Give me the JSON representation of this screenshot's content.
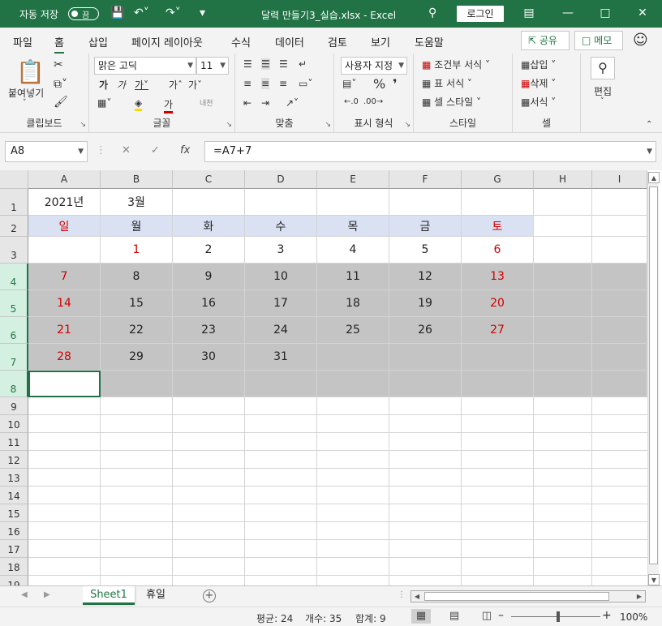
{
  "titlebar": {
    "autosave_label": "자동 저장",
    "autosave_state": "끔",
    "document_title": "달력 만들기3_실습.xlsx  -  Excel",
    "login_label": "로그인"
  },
  "menu": {
    "tabs": [
      "파일",
      "홈",
      "삽입",
      "페이지 레이아웃",
      "수식",
      "데이터",
      "검토",
      "보기",
      "도움말"
    ],
    "active_tab": "홈",
    "share_label": "공유",
    "memo_label": "메모"
  },
  "ribbon": {
    "clipboard": {
      "label": "클립보드",
      "paste_label": "붙여넣기"
    },
    "font": {
      "label": "글꼴",
      "font_name": "맑은 고딕",
      "font_size": "11"
    },
    "alignment": {
      "label": "맞춤"
    },
    "number": {
      "label": "표시 형식",
      "format": "사용자 지정"
    },
    "styles": {
      "label": "스타일",
      "conditional": "조건부 서식",
      "table": "표 서식",
      "cell": "셀 스타일"
    },
    "cells": {
      "label": "셀",
      "insert": "삽입",
      "delete": "삭제",
      "format": "서식"
    },
    "editing": {
      "label": "편집"
    }
  },
  "formula_bar": {
    "name_box": "A8",
    "formula": "=A7+7",
    "fx": "fx"
  },
  "columns": [
    "A",
    "B",
    "C",
    "D",
    "E",
    "F",
    "G",
    "H",
    "I"
  ],
  "rows": [
    "1",
    "2",
    "3",
    "4",
    "5",
    "6",
    "7",
    "8",
    "9",
    "10",
    "11",
    "12",
    "13",
    "14",
    "15",
    "16",
    "17",
    "18",
    "19"
  ],
  "sheet": {
    "year": "2021년",
    "month": "3월",
    "weekdays": [
      "일",
      "월",
      "화",
      "수",
      "목",
      "금",
      "토"
    ],
    "week1": [
      "",
      "1",
      "2",
      "3",
      "4",
      "5",
      "6"
    ],
    "week2": [
      "7",
      "8",
      "9",
      "10",
      "11",
      "12",
      "13"
    ],
    "week3": [
      "14",
      "15",
      "16",
      "17",
      "18",
      "19",
      "20"
    ],
    "week4": [
      "21",
      "22",
      "23",
      "24",
      "25",
      "26",
      "27"
    ],
    "week5": [
      "28",
      "29",
      "30",
      "31",
      "",
      "",
      ""
    ]
  },
  "sheet_tabs": [
    "Sheet1",
    "휴일"
  ],
  "active_sheet": "Sheet1",
  "status": {
    "average": "평균: 24",
    "count": "개수: 35",
    "sum": "합계: 9",
    "zoom": "100%"
  },
  "colors": {
    "accent": "#217346",
    "weekend_red": "#d00000",
    "header_fill": "#d9e1f2",
    "selected_fill": "#c4c4c4"
  }
}
